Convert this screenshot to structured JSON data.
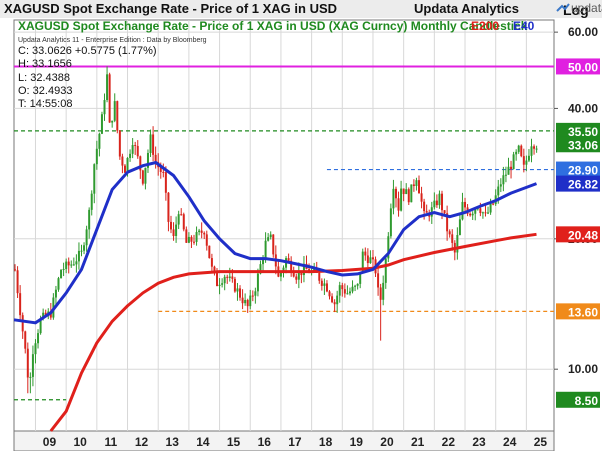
{
  "chart_data": {
    "type": "candlestick",
    "title": "XAGUSD Spot Exchange Rate - Price of 1 XAG in USD",
    "publisher": "Updata Analytics",
    "subtitle": "XAGUSD Spot Exchange Rate - Price of 1 XAG in USD (XAG Curncy) Monthly Candlestick",
    "legend": [
      {
        "label": "E200",
        "color": "#e0201b"
      },
      {
        "label": "E40",
        "color": "#1f2fc8"
      }
    ],
    "credit": "Updata Analytics 11 - Enterprise Edition : Data by Bloomberg",
    "info": {
      "close": "C: 33.0626  +0.5775 (1.77%)",
      "high": "H: 33.1656",
      "low": "L: 32.4388",
      "open": "O: 32.4933",
      "time": "T: 14:55:08"
    },
    "logo": "updata",
    "yscale": "log",
    "ylim": [
      7.2,
      64
    ],
    "xlim": [
      2008.3,
      2025.9
    ],
    "scale_label": "Log",
    "yticks": [
      60,
      40,
      20,
      10
    ],
    "ytick_labels": [
      "60.00",
      "40.00",
      "20.00",
      "10.00"
    ],
    "xticks": [
      2009,
      2010,
      2011,
      2012,
      2013,
      2014,
      2015,
      2016,
      2017,
      2018,
      2019,
      2020,
      2021,
      2022,
      2023,
      2024,
      2025
    ],
    "xtick_labels": [
      "09",
      "10",
      "11",
      "12",
      "13",
      "14",
      "15",
      "16",
      "17",
      "18",
      "19",
      "20",
      "21",
      "22",
      "23",
      "24",
      "25"
    ],
    "close_points": [
      [
        2008.33,
        17.0
      ],
      [
        2008.67,
        11.0
      ],
      [
        2008.8,
        9.0
      ],
      [
        2008.92,
        11.2
      ],
      [
        2009.17,
        13.0
      ],
      [
        2009.5,
        13.5
      ],
      [
        2009.83,
        17.0
      ],
      [
        2010.17,
        17.5
      ],
      [
        2010.5,
        18.5
      ],
      [
        2010.75,
        23.0
      ],
      [
        2010.92,
        30.0
      ],
      [
        2011.17,
        38.0
      ],
      [
        2011.33,
        48.0
      ],
      [
        2011.42,
        36.0
      ],
      [
        2011.58,
        41.0
      ],
      [
        2011.75,
        31.0
      ],
      [
        2011.92,
        29.0
      ],
      [
        2012.17,
        34.0
      ],
      [
        2012.5,
        27.5
      ],
      [
        2012.75,
        34.0
      ],
      [
        2012.92,
        30.0
      ],
      [
        2013.17,
        28.0
      ],
      [
        2013.33,
        22.0
      ],
      [
        2013.5,
        20.0
      ],
      [
        2013.67,
        23.5
      ],
      [
        2013.92,
        19.5
      ],
      [
        2014.17,
        20.0
      ],
      [
        2014.5,
        21.0
      ],
      [
        2014.75,
        17.0
      ],
      [
        2014.92,
        15.8
      ],
      [
        2015.17,
        16.5
      ],
      [
        2015.5,
        15.5
      ],
      [
        2015.75,
        14.5
      ],
      [
        2015.92,
        13.9
      ],
      [
        2016.17,
        15.5
      ],
      [
        2016.5,
        19.5
      ],
      [
        2016.67,
        20.0
      ],
      [
        2016.92,
        16.2
      ],
      [
        2017.17,
        18.0
      ],
      [
        2017.5,
        16.5
      ],
      [
        2017.75,
        17.0
      ],
      [
        2017.92,
        16.9
      ],
      [
        2018.17,
        16.5
      ],
      [
        2018.5,
        15.5
      ],
      [
        2018.75,
        14.2
      ],
      [
        2018.92,
        15.5
      ],
      [
        2019.17,
        15.0
      ],
      [
        2019.5,
        15.5
      ],
      [
        2019.67,
        18.5
      ],
      [
        2019.92,
        17.9
      ],
      [
        2020.08,
        17.0
      ],
      [
        2020.22,
        14.0
      ],
      [
        2020.42,
        18.0
      ],
      [
        2020.58,
        24.0
      ],
      [
        2020.67,
        27.0
      ],
      [
        2020.83,
        23.5
      ],
      [
        2020.92,
        26.4
      ],
      [
        2021.17,
        25.0
      ],
      [
        2021.42,
        28.0
      ],
      [
        2021.67,
        22.5
      ],
      [
        2021.92,
        23.3
      ],
      [
        2022.17,
        25.0
      ],
      [
        2022.42,
        21.0
      ],
      [
        2022.67,
        18.5
      ],
      [
        2022.92,
        24.0
      ],
      [
        2023.17,
        23.0
      ],
      [
        2023.42,
        24.0
      ],
      [
        2023.67,
        22.5
      ],
      [
        2023.92,
        24.1
      ],
      [
        2024.17,
        27.0
      ],
      [
        2024.42,
        29.0
      ],
      [
        2024.75,
        32.0
      ],
      [
        2024.92,
        29.0
      ],
      [
        2025.17,
        33.5
      ],
      [
        2025.33,
        33.06
      ]
    ],
    "low_spikes": [
      {
        "x": 2008.8,
        "low": 8.8
      },
      {
        "x": 2020.22,
        "low": 11.64
      }
    ],
    "e40_points": [
      [
        2008.3,
        13.0
      ],
      [
        2009.0,
        12.8
      ],
      [
        2009.5,
        13.5
      ],
      [
        2010.0,
        15.0
      ],
      [
        2010.5,
        17.0
      ],
      [
        2011.0,
        21.0
      ],
      [
        2011.5,
        26.0
      ],
      [
        2012.0,
        28.5
      ],
      [
        2012.5,
        29.5
      ],
      [
        2012.92,
        30.0
      ],
      [
        2013.5,
        28.0
      ],
      [
        2014.0,
        25.0
      ],
      [
        2014.5,
        22.0
      ],
      [
        2015.0,
        20.0
      ],
      [
        2015.5,
        18.5
      ],
      [
        2016.0,
        18.0
      ],
      [
        2016.5,
        18.0
      ],
      [
        2017.0,
        17.8
      ],
      [
        2017.5,
        17.5
      ],
      [
        2018.0,
        17.2
      ],
      [
        2018.5,
        16.8
      ],
      [
        2019.0,
        16.5
      ],
      [
        2019.5,
        16.6
      ],
      [
        2020.0,
        17.0
      ],
      [
        2020.5,
        18.5
      ],
      [
        2021.0,
        21.0
      ],
      [
        2021.5,
        22.5
      ],
      [
        2022.0,
        23.0
      ],
      [
        2022.5,
        22.5
      ],
      [
        2023.0,
        23.0
      ],
      [
        2023.5,
        23.8
      ],
      [
        2024.0,
        24.5
      ],
      [
        2024.5,
        25.5
      ],
      [
        2025.33,
        26.82
      ]
    ],
    "e200_points": [
      [
        2009.5,
        6.0
      ],
      [
        2010.0,
        8.0
      ],
      [
        2010.5,
        9.8
      ],
      [
        2011.0,
        11.5
      ],
      [
        2011.5,
        12.9
      ],
      [
        2012.0,
        14.0
      ],
      [
        2012.5,
        15.0
      ],
      [
        2013.0,
        15.8
      ],
      [
        2013.5,
        16.3
      ],
      [
        2014.0,
        16.6
      ],
      [
        2014.5,
        16.7
      ],
      [
        2015.0,
        16.8
      ],
      [
        2016.0,
        16.8
      ],
      [
        2017.0,
        16.8
      ],
      [
        2018.0,
        16.8
      ],
      [
        2019.0,
        16.9
      ],
      [
        2020.0,
        17.1
      ],
      [
        2020.5,
        17.4
      ],
      [
        2021.0,
        17.9
      ],
      [
        2022.0,
        18.6
      ],
      [
        2023.0,
        19.2
      ],
      [
        2024.0,
        19.8
      ],
      [
        2024.5,
        20.1
      ],
      [
        2025.33,
        20.48
      ]
    ],
    "levels": [
      {
        "value": 50.0,
        "label": "50.00",
        "color": "#e020e0",
        "style": "solid",
        "x_from": 2008.3,
        "text_color": "#ffffff"
      },
      {
        "value": 35.5,
        "label": "35.50",
        "color": "#1f8a1f",
        "style": "dashed",
        "x_from": 2008.3,
        "text_color": "#ffffff"
      },
      {
        "value": 28.9,
        "label": "28.90",
        "color": "#2f6fe0",
        "style": "dashed",
        "x_from": 2018.5,
        "text_color": "#ffffff"
      },
      {
        "value": 13.6,
        "label": "13.60",
        "color": "#f08a1a",
        "style": "dashed",
        "x_from": 2013.0,
        "text_color": "#ffffff"
      },
      {
        "value": 8.5,
        "label": "8.50",
        "color": "#1f8a1f",
        "style": "dashed",
        "x_from": 2008.3,
        "x_to": 2010.0,
        "text_color": "#ffffff"
      }
    ],
    "markers": [
      {
        "value": 33.06,
        "label": "33.06",
        "color": "#1f8a1f",
        "text_color": "#ffffff"
      },
      {
        "value": 26.82,
        "label": "26.82",
        "color": "#1f2fc8",
        "text_color": "#ffffff"
      },
      {
        "value": 20.48,
        "label": "20.48",
        "color": "#e0201b",
        "text_color": "#ffffff"
      }
    ],
    "colors": {
      "up": "#2f9a2f",
      "down": "#d8241c",
      "grid": "#d8d8d8",
      "title_bg": "#e8e8e8"
    }
  }
}
